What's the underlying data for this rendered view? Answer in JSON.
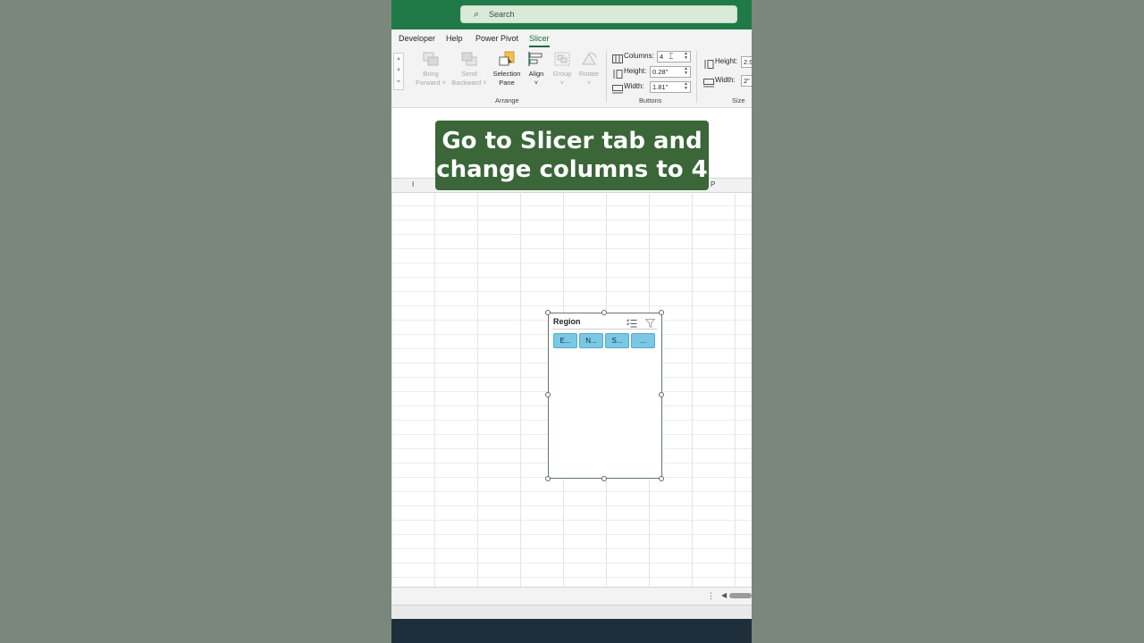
{
  "search": {
    "placeholder": "Search"
  },
  "tabs": [
    "Developer",
    "Help",
    "Power Pivot",
    "Slicer"
  ],
  "active_tab": "Slicer",
  "ribbon": {
    "arrange": {
      "group_label": "Arrange",
      "bring_forward": [
        "Bring",
        "Forward ˅"
      ],
      "send_backward": [
        "Send",
        "Backward ˅"
      ],
      "selection_pane": [
        "Selection",
        "Pane"
      ],
      "align": [
        "Align",
        "˅"
      ],
      "group": [
        "Group",
        "˅"
      ],
      "rotate": [
        "Rotate",
        "˅"
      ]
    },
    "buttons": {
      "group_label": "Buttons",
      "columns_label": "Columns:",
      "columns_value": "4",
      "height_label": "Height:",
      "height_value": "0.28\"",
      "width_label": "Width:",
      "width_value": "1.81\""
    },
    "size": {
      "group_label": "Size",
      "height_label": "Height:",
      "height_value": "2.9",
      "width_label": "Width:",
      "width_value": "2\""
    }
  },
  "sheet": {
    "column_headers": [
      "I",
      "P"
    ]
  },
  "callout": {
    "line1": "Go to Slicer tab and",
    "line2": "change columns to 4"
  },
  "slicer": {
    "title": "Region",
    "buttons": [
      "E...",
      "N...",
      "S...",
      "..."
    ]
  },
  "colors": {
    "title_bar": "#1f7a47",
    "callout_bg": "#3a6638",
    "slicer_button": "#78c8e6",
    "active_tab": "#1d6b3d"
  },
  "icons": [
    "search-icon",
    "multi-select-icon",
    "clear-filter-icon",
    "columns-icon",
    "height-icon",
    "width-icon"
  ]
}
